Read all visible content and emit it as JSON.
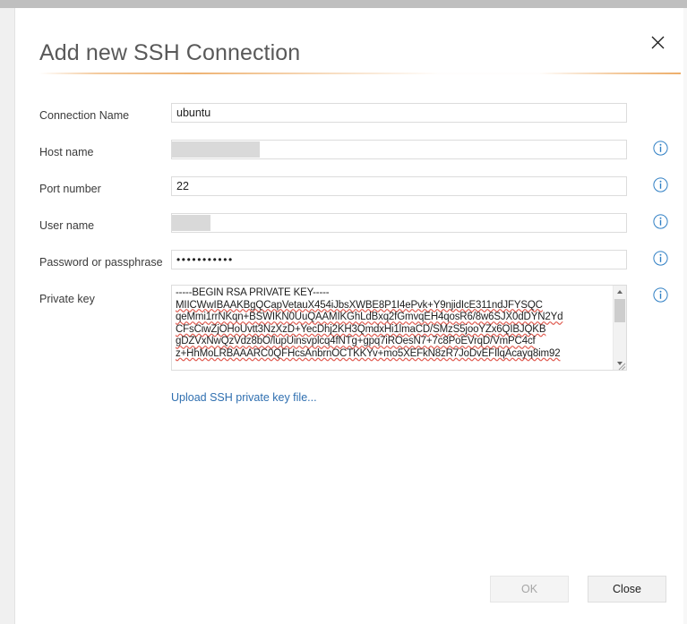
{
  "window": {
    "title": "Add new SSH Connection",
    "close_icon": "close-x-icon"
  },
  "theme": {
    "accent_rule": "#eaa050",
    "link": "#2f6fb0",
    "info_icon": "#2f7fc4",
    "title_text": "#595959",
    "spellcheck_underline": "#e05a4f"
  },
  "fields": {
    "connection_name": {
      "label": "Connection Name",
      "value": "ubuntu",
      "placeholder": "",
      "has_info": false,
      "redacted": false
    },
    "host_name": {
      "label": "Host name",
      "value": "",
      "placeholder": "",
      "has_info": true,
      "redacted": true
    },
    "port_number": {
      "label": "Port number",
      "value": "22",
      "placeholder": "",
      "has_info": true,
      "redacted": false
    },
    "user_name": {
      "label": "User name",
      "value": "",
      "placeholder": "",
      "has_info": true,
      "redacted": true
    },
    "password": {
      "label": "Password or passphrase",
      "value": "•••••••••••",
      "placeholder": "",
      "has_info": true,
      "redacted": false
    },
    "private_key": {
      "label": "Private key",
      "has_info": true,
      "lines": [
        "-----BEGIN RSA PRIVATE KEY-----",
        "MIICWwIBAAKBgQCapVetauX454iJbsXWBE8P1I4ePvk+Y9njidIcE311ndJFYSQC",
        "qeMmi1rrNKqn+BSWIKN0UuQAAMIKGhLdBxq2fGmvqEH4qosR6/8w6SJX0dDYN2Yd",
        "CFsCiwZjOHoUvtt3NzXzD+YecDhj2KH3QmdxHi1lmaCD/SMzS5jooYZx6QIBJQKB",
        "gDZVxNwQzVdz8bO/lupUinsvplcq4fNTg+gpq7iROesN7+7c8PoEVrqD/VmPC4cf",
        "z+HhMoLRBAAARC0QFHcsAnbrnOCTKKYv+mo5XEFkN8zR7JoDvEFIlqAcayq8im92"
      ]
    }
  },
  "upload_link": {
    "label": "Upload SSH private key file...",
    "icon": "upload-icon"
  },
  "footer": {
    "ok_label": "OK",
    "ok_disabled": true,
    "close_label": "Close"
  },
  "scrollbar": {
    "up_icon": "scroll-up-arrow-icon",
    "down_icon": "scroll-down-arrow-icon"
  }
}
